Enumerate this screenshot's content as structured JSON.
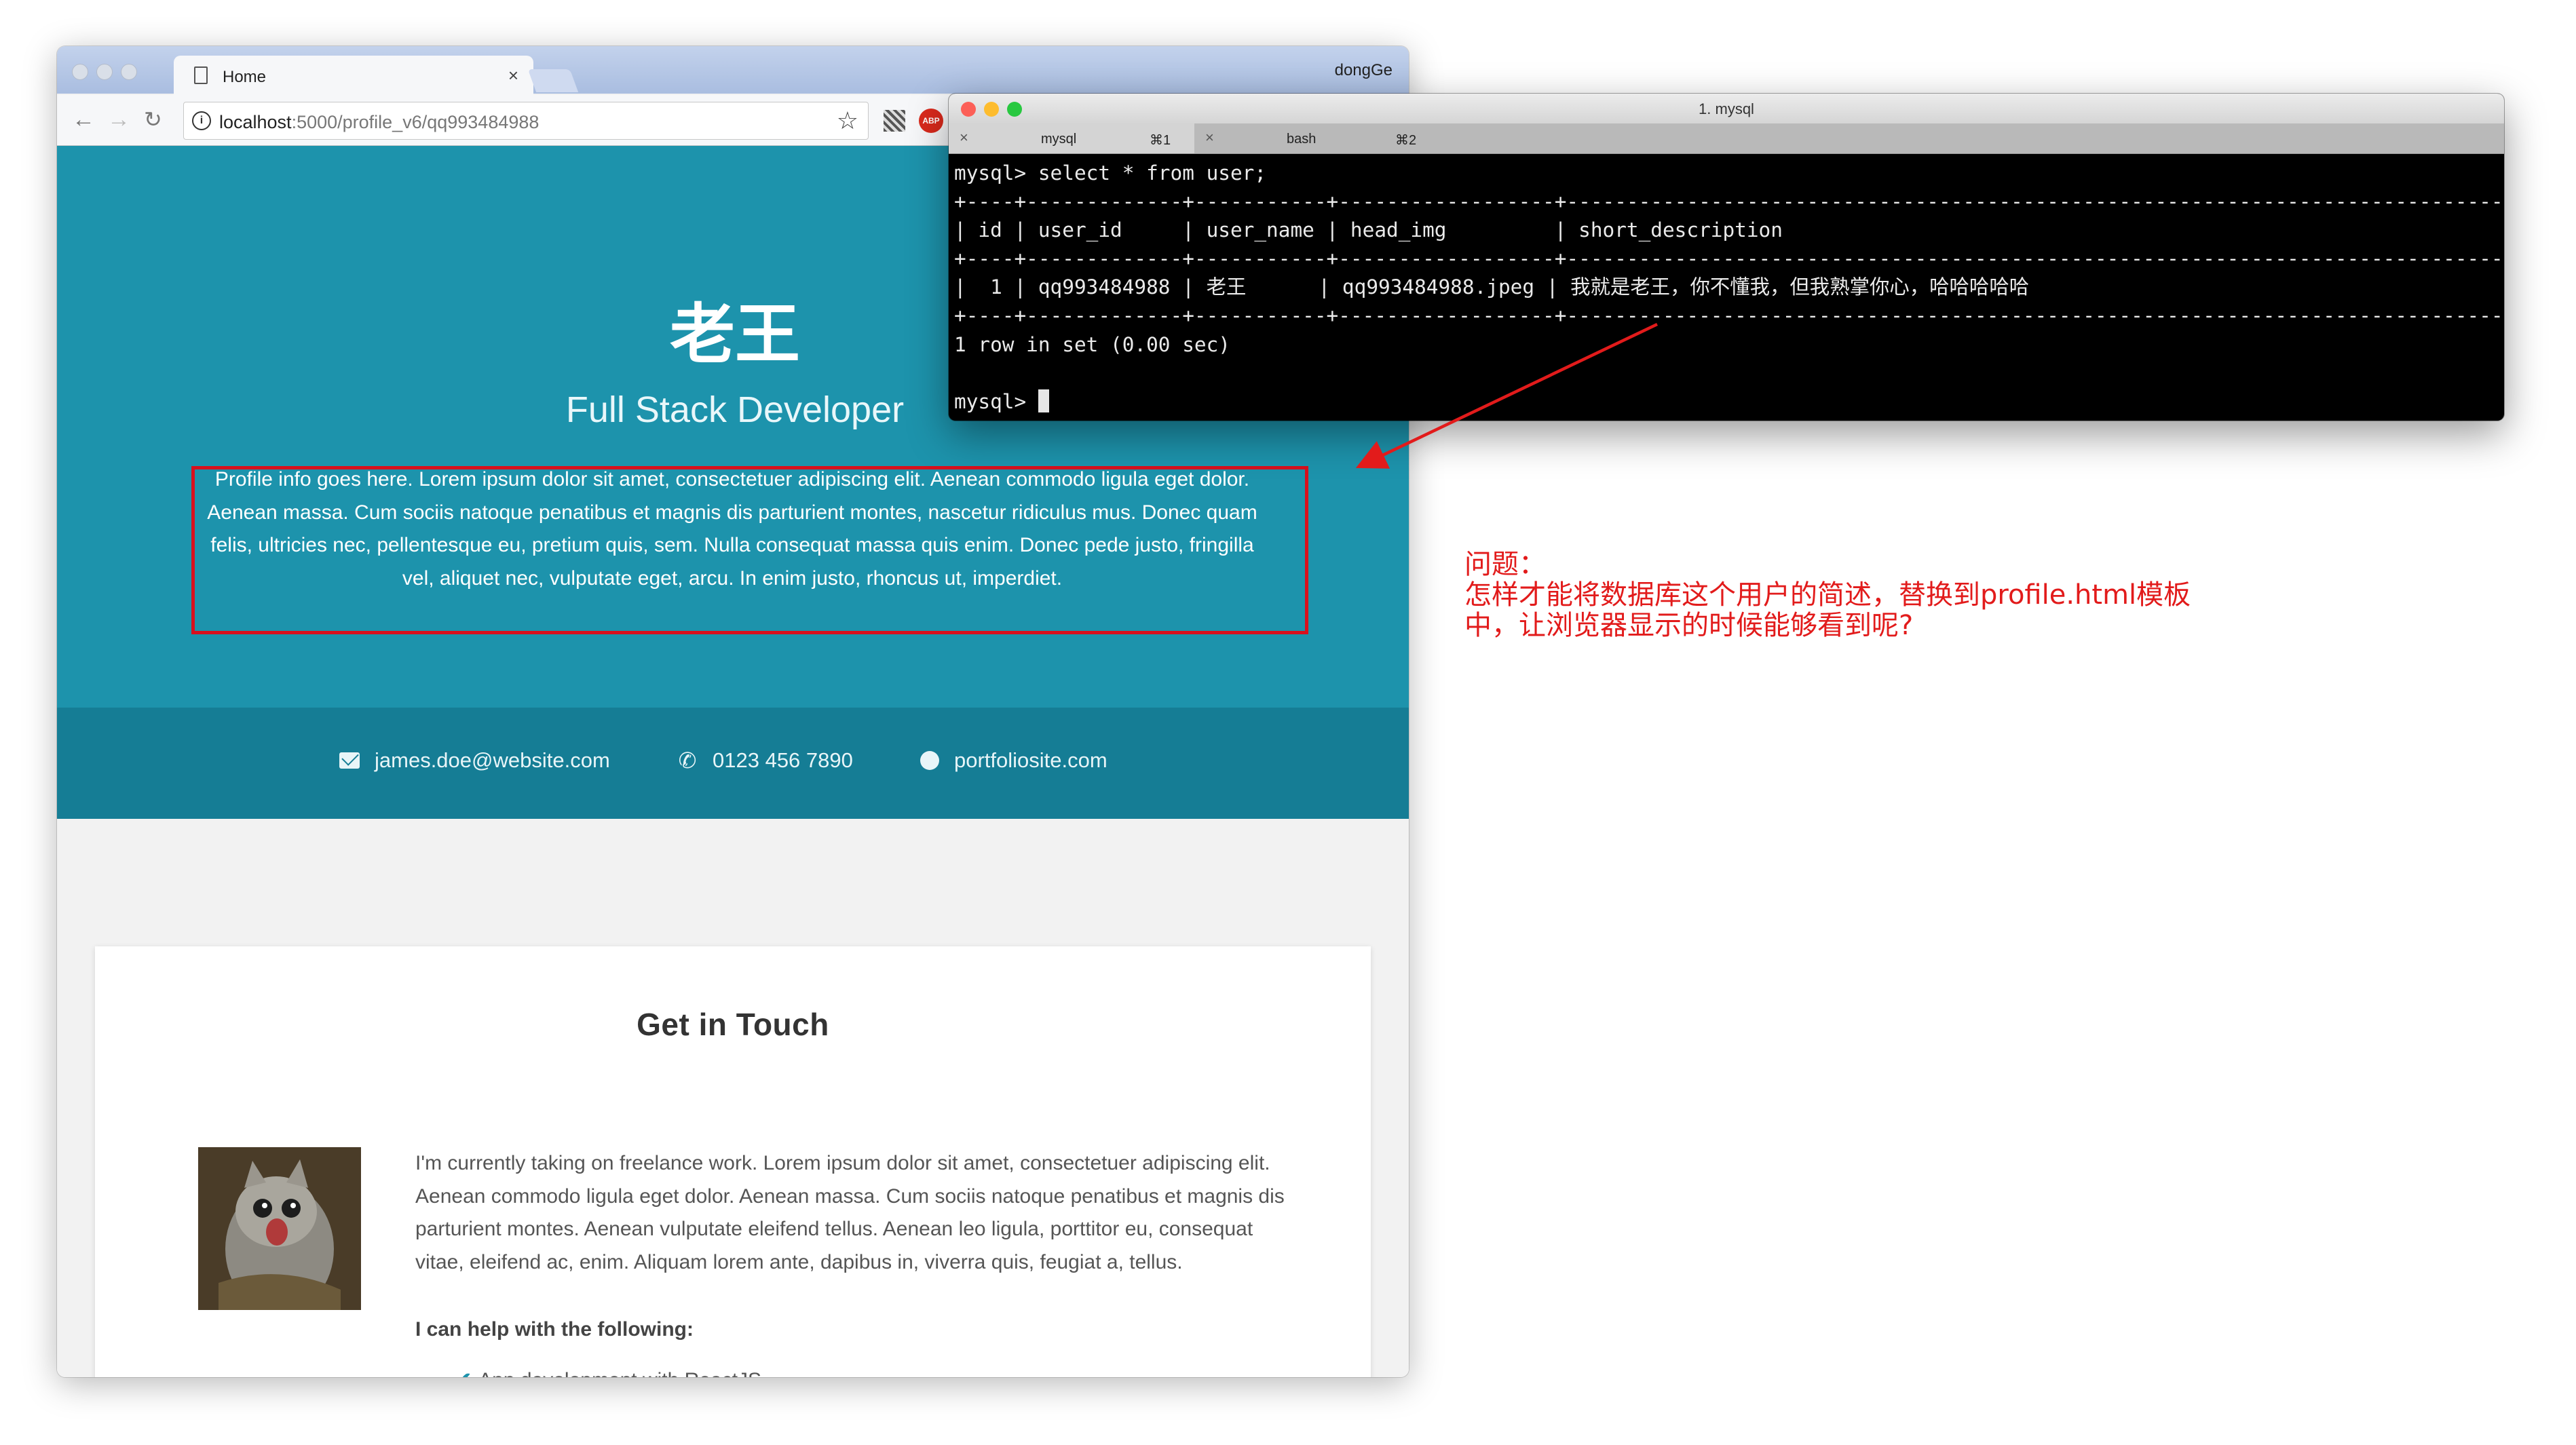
{
  "browser": {
    "tab_title": "Home",
    "tab_close": "×",
    "profile_name": "dongGe",
    "url_host": "localhost",
    "url_path": ":5000/profile_v6/qq993484988",
    "abp_label": "ABP"
  },
  "hero": {
    "name": "老王",
    "role": "Full Stack Developer",
    "description": "Profile info goes here. Lorem ipsum dolor sit amet, consectetuer adipiscing elit. Aenean commodo ligula eget dolor. Aenean massa. Cum sociis natoque penatibus et magnis dis parturient montes, nascetur ridiculus mus. Donec quam felis, ultricies nec, pellentesque eu, pretium quis, sem. Nulla consequat massa quis enim. Donec pede justo, fringilla vel, aliquet nec, vulputate eget, arcu. In enim justo, rhoncus ut, imperdiet."
  },
  "contact": {
    "email": "james.doe@website.com",
    "phone": "0123 456 7890",
    "website": "portfoliosite.com"
  },
  "card": {
    "title": "Get in Touch",
    "about": "I'm currently taking on freelance work. Lorem ipsum dolor sit amet, consectetuer adipiscing elit. Aenean commodo ligula eget dolor. Aenean massa. Cum sociis natoque penatibus et magnis dis parturient montes. Aenean vulputate eleifend tellus. Aenean leo ligula, porttitor eu, consequat vitae, eleifend ac, enim. Aliquam lorem ante, dapibus in, viverra quis, feugiat a, tellus.",
    "help_heading": "I can help with the following:",
    "help_item": "App development with ReactJS"
  },
  "terminal": {
    "title": "1. mysql",
    "tabs": [
      {
        "label": "mysql",
        "shortcut": "⌘1"
      },
      {
        "label": "bash",
        "shortcut": "⌘2"
      }
    ],
    "tab_close": "×",
    "lines": [
      "mysql> select * from user;",
      "+----+-------------+-----------+------------------+-----------------------------------------------------------------------------------------+",
      "| id | user_id     | user_name | head_img         | short_description                                                                       |",
      "+----+-------------+-----------+------------------+-----------------------------------------------------------------------------------------+",
      "|  1 | qq993484988 | 老王      | qq993484988.jpeg | 我就是老王，你不懂我，但我熟掌你心，哈哈哈哈哈                                          |",
      "+----+-------------+-----------+------------------+-----------------------------------------------------------------------------------------+",
      "1 row in set (0.00 sec)",
      ""
    ],
    "prompt": "mysql> "
  },
  "annotation": {
    "line1": "问题：",
    "line2": "怎样才能将数据库这个用户的简述，替换到profile.html模板",
    "line3": "中，让浏览器显示的时候能够看到呢?"
  },
  "colors": {
    "hero_bg": "#1d93ac",
    "contact_bg": "#157d95",
    "annotation_red": "#e21b1b",
    "terminal_bg": "#000000"
  }
}
